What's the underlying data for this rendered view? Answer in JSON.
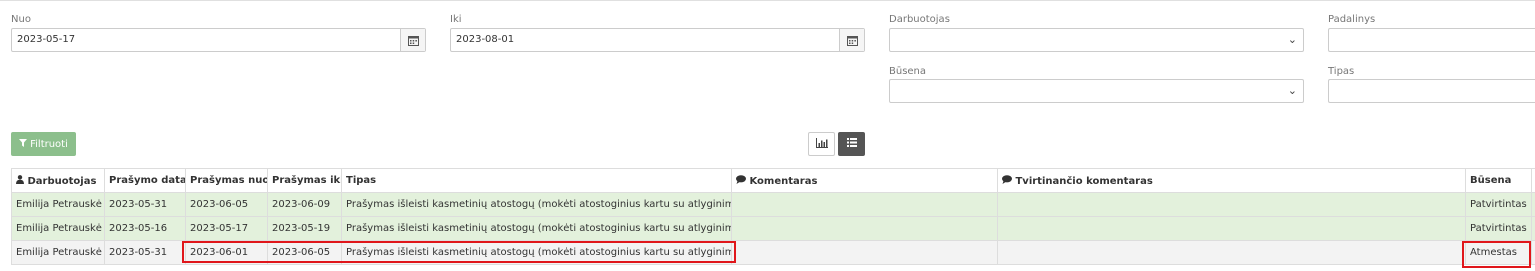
{
  "filters": {
    "nuo": {
      "label": "Nuo",
      "value": "2023-05-17",
      "icon": "calendar-icon"
    },
    "iki": {
      "label": "Iki",
      "value": "2023-08-01",
      "icon": "calendar-icon"
    },
    "darbuotojas": {
      "label": "Darbuotojas",
      "value": ""
    },
    "padalinys": {
      "label": "Padalinys",
      "value": ""
    },
    "busena": {
      "label": "Būsena",
      "value": ""
    },
    "tipas": {
      "label": "Tipas",
      "value": ""
    }
  },
  "toolbar": {
    "filter_label": "Filtruoti",
    "filter_icon": "filter-icon",
    "chart_view_icon": "bar-chart-icon",
    "list_view_icon": "list-icon"
  },
  "table": {
    "headers": {
      "darbuotojas": "Darbuotojas",
      "prasymo_data": "Prašymo data",
      "prasymas_nuo": "Prašymas nuo",
      "prasymas_iki": "Prašymas iki",
      "tipas": "Tipas",
      "komentaras": "Komentaras",
      "tvirtinancio": "Tvirtinančio komentaras",
      "busena": "Būsena"
    },
    "rows": [
      {
        "darbuotojas": "Emilija Petrauskė",
        "prasymo_data": "2023-05-31",
        "prasymas_nuo": "2023-06-05",
        "prasymas_iki": "2023-06-09",
        "tipas": "Prašymas išleisti kasmetinių atostogų (mokėti atostoginius kartu su atlyginimu)",
        "komentaras": "",
        "tvirtinancio": "",
        "busena": "Patvirtintas"
      },
      {
        "darbuotojas": "Emilija Petrauskė",
        "prasymo_data": "2023-05-16",
        "prasymas_nuo": "2023-05-17",
        "prasymas_iki": "2023-05-19",
        "tipas": "Prašymas išleisti kasmetinių atostogų (mokėti atostoginius kartu su atlyginimu)",
        "komentaras": "",
        "tvirtinancio": "",
        "busena": "Patvirtintas"
      },
      {
        "darbuotojas": "Emilija Petrauskė",
        "prasymo_data": "2023-05-31",
        "prasymas_nuo": "2023-06-01",
        "prasymas_iki": "2023-06-05",
        "tipas": "Prašymas išleisti kasmetinių atostogų (mokėti atostoginius kartu su atlyginimu)",
        "komentaras": "",
        "tvirtinancio": "",
        "busena": "Atmestas"
      }
    ]
  },
  "colors": {
    "approved_row": "#e3f1dc",
    "rejected_row": "#f3f3f3",
    "filter_button": "#8cbf8c",
    "highlight": "#e0161b"
  }
}
